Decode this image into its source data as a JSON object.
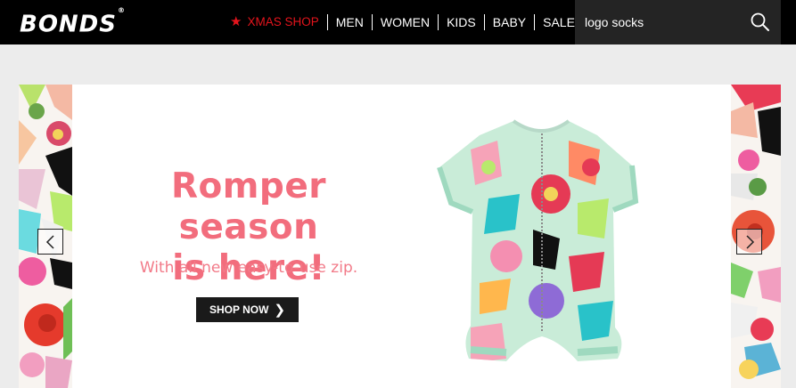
{
  "brand": {
    "logo": "BONDS",
    "mark": "®"
  },
  "nav": {
    "items": [
      {
        "label": "XMAS SHOP",
        "icon": "star-icon"
      },
      {
        "label": "MEN"
      },
      {
        "label": "WOMEN"
      },
      {
        "label": "KIDS"
      },
      {
        "label": "BABY"
      },
      {
        "label": "SALE"
      }
    ],
    "accent_color": "#e4141c"
  },
  "search": {
    "value": "logo socks",
    "icon": "search-icon"
  },
  "hero": {
    "headline_line1": "Romper season",
    "headline_line2": "is here!",
    "subhead": "With all new easy-to-use zip.",
    "cta_label": "SHOP NOW",
    "accent_color": "#f26d7d",
    "prev_icon": "chevron-left-icon",
    "next_icon": "chevron-right-icon"
  }
}
